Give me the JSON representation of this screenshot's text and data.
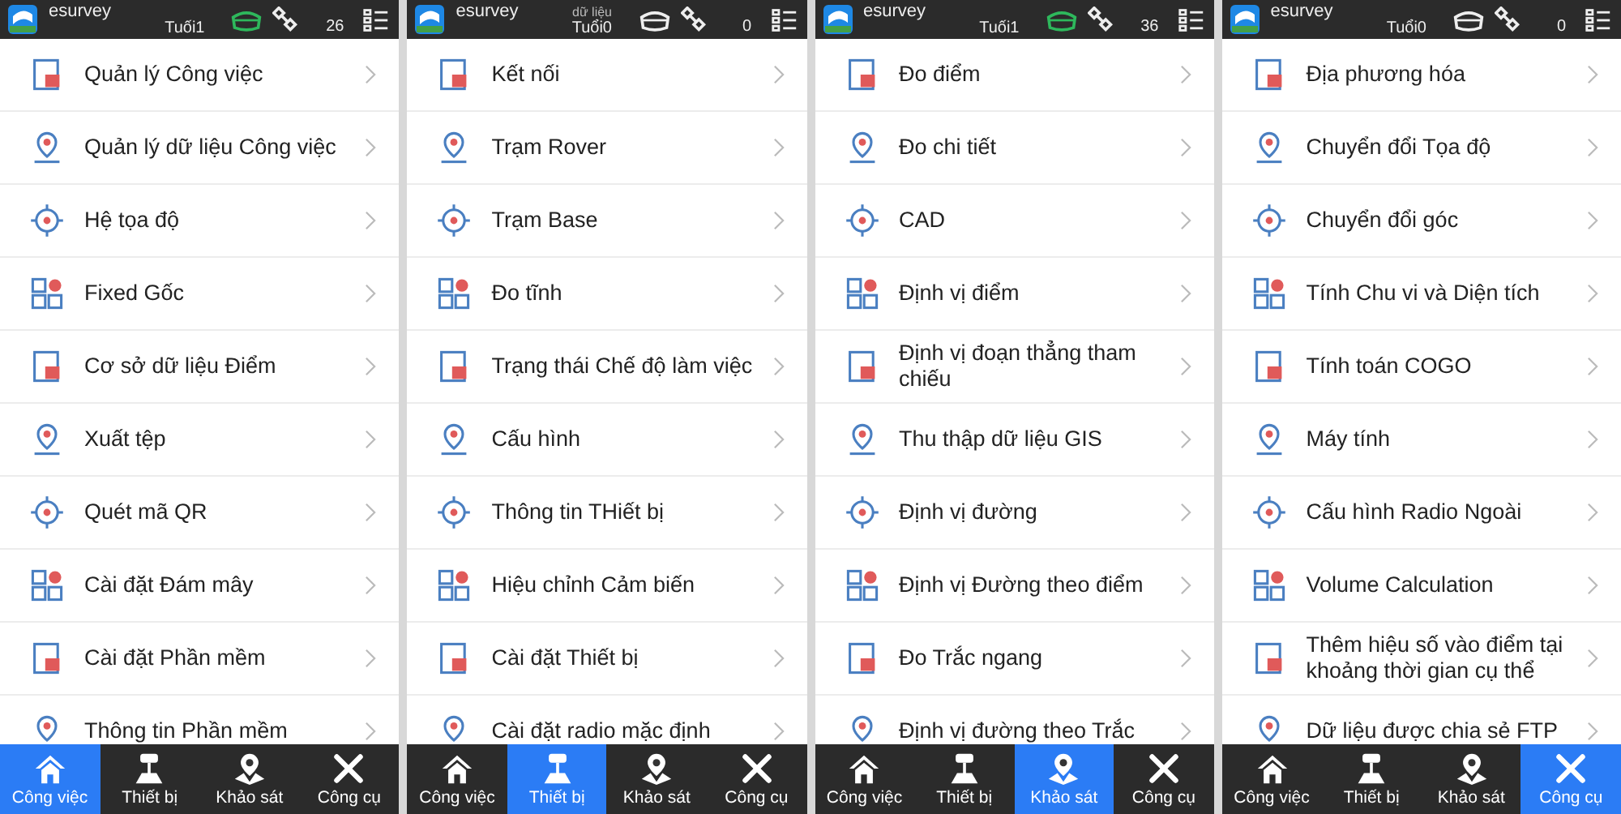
{
  "screens": [
    {
      "app_name": "esurvey",
      "status": "Tuối1",
      "receiver_connected": true,
      "satellites": "26",
      "menu": [
        "Quản lý Công việc",
        "Quản lý dữ liệu Công việc",
        "Hệ tọa độ",
        "Fixed Gốc",
        "Cơ sở dữ liệu Điểm",
        "Xuất tệp",
        "Quét mã QR",
        "Cài đặt Đám mây",
        "Cài đặt Phần mềm",
        "Thông tin Phần mềm"
      ],
      "tabs": [
        {
          "label": "Công việc",
          "selected": true
        },
        {
          "label": "Thiết bị",
          "selected": false
        },
        {
          "label": "Khảo sát",
          "selected": false
        },
        {
          "label": "Công cụ",
          "selected": false
        }
      ]
    },
    {
      "app_name": "esurvey",
      "status_top": "dữ liệu",
      "status": "Tuổi0",
      "receiver_connected": false,
      "satellites": "0",
      "menu": [
        "Kết nối",
        "Trạm Rover",
        "Trạm Base",
        "Đo tĩnh",
        "Trạng thái Chế độ làm việc",
        "Cấu hình",
        "Thông tin THiết bị",
        "Hiệu chỉnh Cảm biến",
        "Cài đặt Thiết bị",
        "Cài đặt radio mặc định"
      ],
      "tabs": [
        {
          "label": "Công việc",
          "selected": false
        },
        {
          "label": "Thiết bị",
          "selected": true
        },
        {
          "label": "Khảo sát",
          "selected": false
        },
        {
          "label": "Công cụ",
          "selected": false
        }
      ]
    },
    {
      "app_name": "esurvey",
      "status": "Tuối1",
      "receiver_connected": true,
      "satellites": "36",
      "menu": [
        "Đo điểm",
        "Đo chi tiết",
        "CAD",
        "Định vị điểm",
        "Định vị đoạn thẳng tham chiếu",
        "Thu thập dữ liệu GIS",
        "Định vị đường",
        "Định vị Đường theo điểm",
        "Đo Trắc ngang",
        "Định vị đường theo Trắc"
      ],
      "tabs": [
        {
          "label": "Công việc",
          "selected": false
        },
        {
          "label": "Thiết bị",
          "selected": false
        },
        {
          "label": "Khảo sát",
          "selected": true
        },
        {
          "label": "Công cụ",
          "selected": false
        }
      ]
    },
    {
      "app_name": "esurvey",
      "status": "Tuổi0",
      "receiver_connected": false,
      "satellites": "0",
      "menu": [
        "Địa phương hóa",
        "Chuyển đổi Tọa độ",
        "Chuyển đổi góc",
        "Tính Chu vi và Diện tích",
        "Tính toán COGO",
        "Máy tính",
        "Cấu hình Radio Ngoài",
        "Volume Calculation",
        "Thêm hiệu số vào điểm tại khoảng thời gian cụ thể",
        "Dữ liệu được chia sẻ FTP"
      ],
      "tabs": [
        {
          "label": "Công việc",
          "selected": false
        },
        {
          "label": "Thiết bị",
          "selected": false
        },
        {
          "label": "Khảo sát",
          "selected": false
        },
        {
          "label": "Công cụ",
          "selected": true
        }
      ]
    }
  ]
}
